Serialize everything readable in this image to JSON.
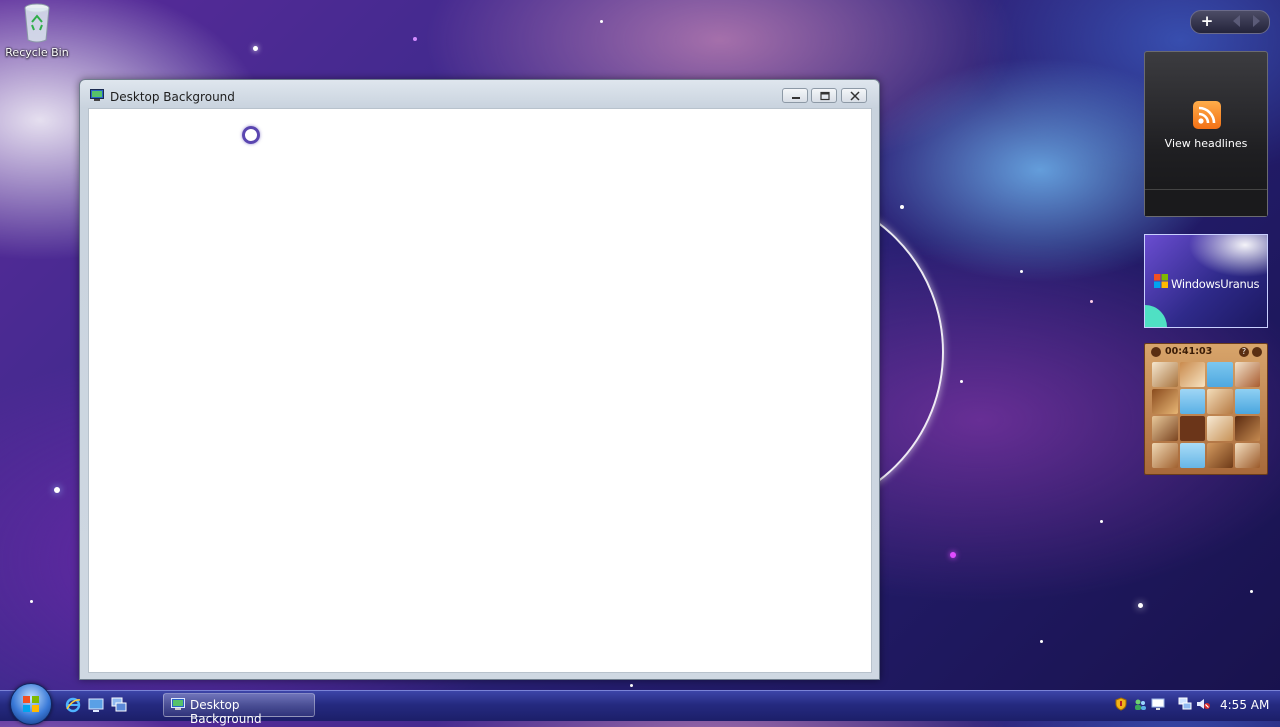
{
  "desktop": {
    "recycle_bin_label": "Recycle Bin"
  },
  "window": {
    "title": "Desktop Background",
    "icon": "monitor-icon",
    "buttons": [
      "minimize-icon",
      "maximize-icon",
      "close-icon"
    ]
  },
  "sidebar": {
    "controls": [
      "plus-icon",
      "previous-arrow-icon",
      "next-arrow-icon"
    ],
    "feed_gadget_label": "View headlines",
    "feed_gadget_icon": "rss-icon",
    "slideshow_text": "WindowsUranus",
    "puzzle_time": "00:41:03"
  },
  "taskbar": {
    "start_icon": "windows-orb-icon",
    "quick_launch": [
      "internet-explorer-icon",
      "show-desktop-icon",
      "switch-windows-icon"
    ],
    "active_task_label": "Desktop Background",
    "tray_icons": [
      "security-shield-icon",
      "users-icon",
      "display-icon",
      "network-icon",
      "volume-muted-icon"
    ],
    "clock": "4:55 AM"
  },
  "colors": {
    "taskbar": "#252a80",
    "window_chrome": "#cfd8e2",
    "feed_orange": "#f27015"
  }
}
